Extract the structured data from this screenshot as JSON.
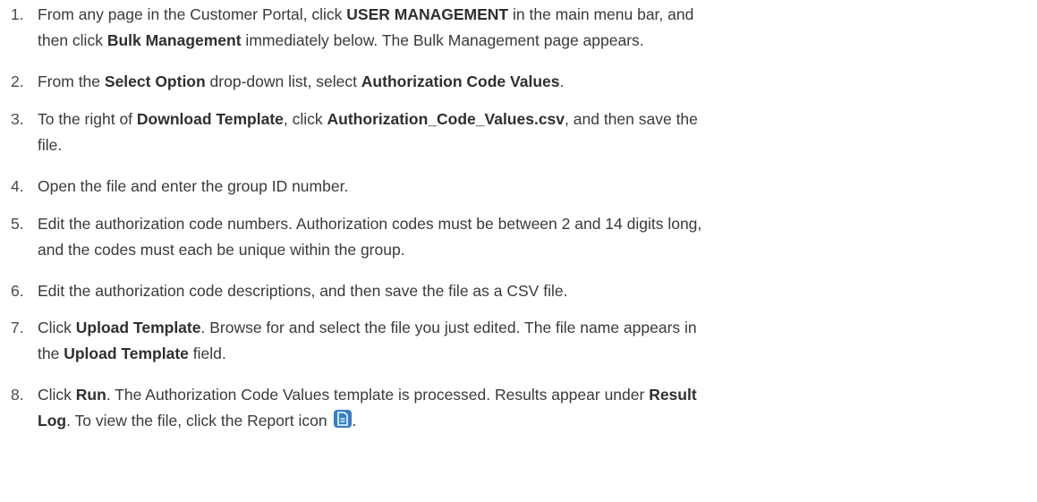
{
  "steps": [
    {
      "number": "1.",
      "lines": [
        [
          {
            "t": "From any page in the Customer Portal, click "
          },
          {
            "t": "USER MANAGEMENT",
            "b": true
          },
          {
            "t": " in the main menu bar, and"
          }
        ],
        [
          {
            "t": "then click "
          },
          {
            "t": "Bulk Management",
            "b": true
          },
          {
            "t": " immediately below. The Bulk Management page appears."
          }
        ]
      ]
    },
    {
      "number": "2.",
      "lines": [
        [
          {
            "t": "From the "
          },
          {
            "t": "Select Option",
            "b": true
          },
          {
            "t": " drop-down list, select "
          },
          {
            "t": "Authorization Code Values",
            "b": true
          },
          {
            "t": "."
          }
        ]
      ]
    },
    {
      "number": "3.",
      "lines": [
        [
          {
            "t": "To the right of "
          },
          {
            "t": "Download Template",
            "b": true
          },
          {
            "t": ", click "
          },
          {
            "t": "Authorization_Code_Values.csv",
            "b": true
          },
          {
            "t": ", and then save the"
          }
        ],
        [
          {
            "t": "file."
          }
        ]
      ]
    },
    {
      "number": "4.",
      "lines": [
        [
          {
            "t": "Open the file and enter the group ID number."
          }
        ]
      ]
    },
    {
      "number": "5.",
      "lines": [
        [
          {
            "t": "Edit the authorization code numbers. Authorization codes must be between 2 and 14 digits long,"
          }
        ],
        [
          {
            "t": "and the codes must each be unique within the group."
          }
        ]
      ]
    },
    {
      "number": "6.",
      "lines": [
        [
          {
            "t": "Edit the authorization code descriptions, and then save the file as a CSV file."
          }
        ]
      ]
    },
    {
      "number": "7.",
      "lines": [
        [
          {
            "t": "Click "
          },
          {
            "t": "Upload Template",
            "b": true
          },
          {
            "t": ". Browse for and select the file you just edited. The file name appears in"
          }
        ],
        [
          {
            "t": "the "
          },
          {
            "t": "Upload Template",
            "b": true
          },
          {
            "t": " field."
          }
        ]
      ]
    },
    {
      "number": "8.",
      "lines": [
        [
          {
            "t": "Click "
          },
          {
            "t": "Run",
            "b": true
          },
          {
            "t": ". The Authorization Code Values template is processed. Results appear under "
          },
          {
            "t": "Result",
            "b": true
          }
        ],
        [
          {
            "t": "Log",
            "b": true
          },
          {
            "t": ". To view the file, click the Report icon "
          },
          {
            "icon": "report-icon"
          },
          {
            "t": "."
          }
        ]
      ]
    }
  ]
}
